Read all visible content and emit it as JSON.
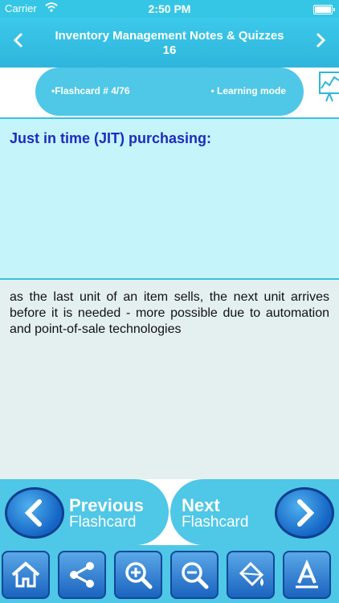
{
  "status_bar": {
    "carrier": "Carrier",
    "time": "2:50 PM"
  },
  "nav": {
    "title_line1": "Inventory Management Notes & Quizzes",
    "title_line2": "16",
    "back_icon": "chevron-left-icon",
    "forward_icon": "chevron-right-icon"
  },
  "info": {
    "flashcard_label": "•Flashcard #  4/76",
    "mode_label": "• Learning mode"
  },
  "card": {
    "question": "Just in time (JIT) purchasing:",
    "answer": "as the last unit of an item sells, the next unit arrives before it is needed - more possible due to automation and point-of-sale technologies"
  },
  "flash_nav": {
    "previous_line1": "Previous",
    "previous_line2": "Flashcard",
    "next_line1": "Next",
    "next_line2": "Flashcard"
  },
  "toolbar": {
    "items": [
      "home-icon",
      "share-icon",
      "zoom-in-icon",
      "zoom-out-icon",
      "paint-bucket-icon",
      "font-icon"
    ]
  },
  "colors": {
    "accent": "#4fc7e7",
    "question_text": "#1d2bbf",
    "question_bg": "#c5f4fb",
    "answer_bg": "#e4f0ef",
    "button_blue": "#1464c4"
  }
}
